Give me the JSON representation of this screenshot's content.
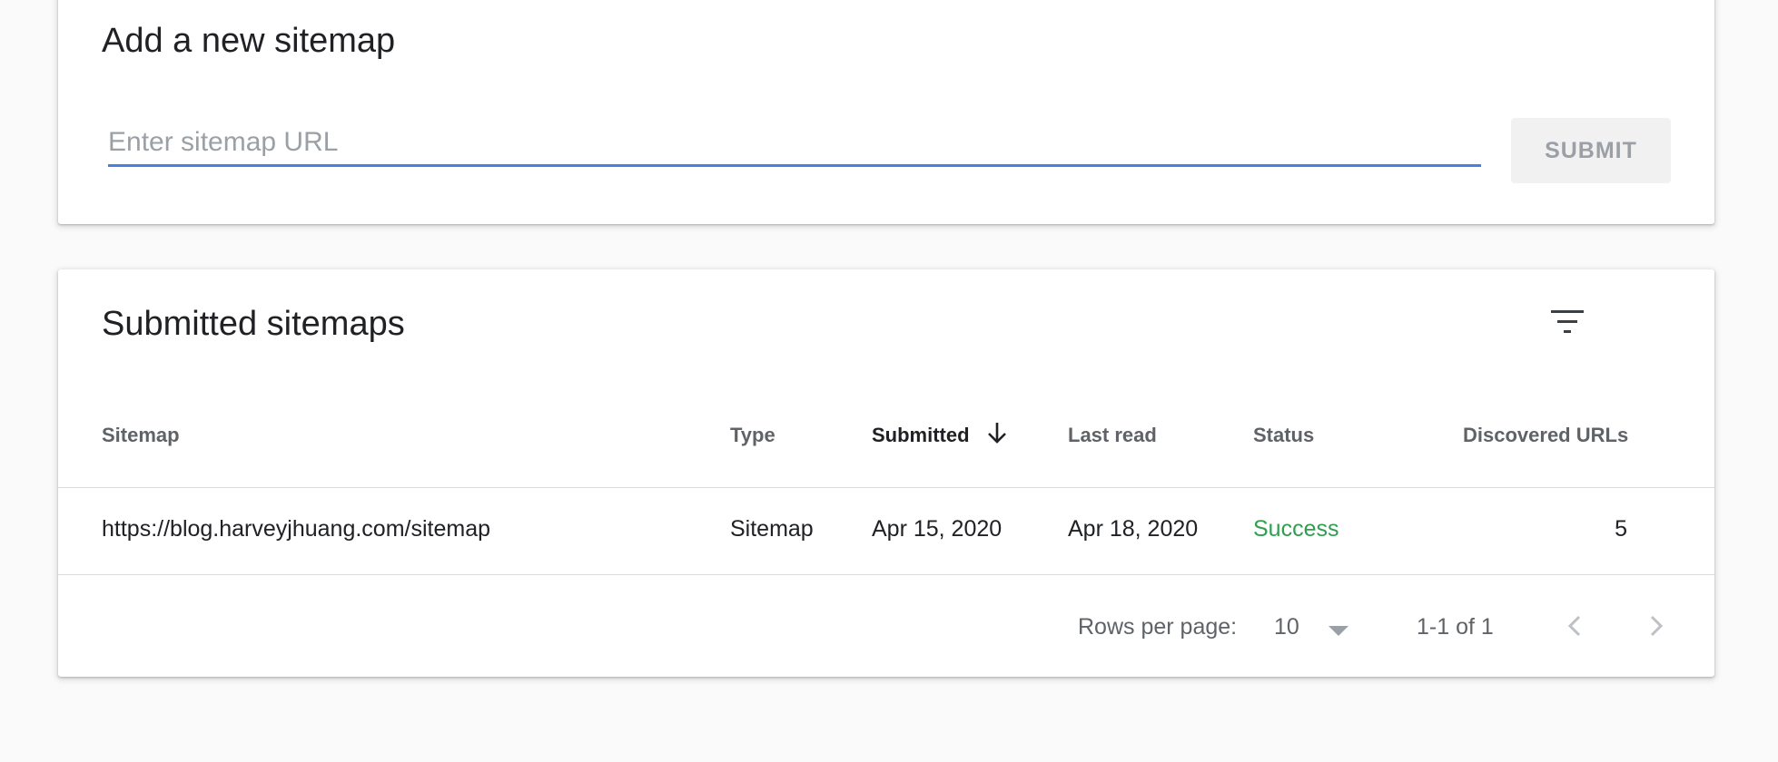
{
  "add_sitemap": {
    "title": "Add a new sitemap",
    "input_placeholder": "Enter sitemap URL",
    "input_value": "",
    "submit_label": "SUBMIT"
  },
  "submitted": {
    "title": "Submitted sitemaps",
    "columns": [
      "Sitemap",
      "Type",
      "Submitted",
      "Last read",
      "Status",
      "Discovered URLs"
    ],
    "sorted_column": "Submitted",
    "sort_direction": "descending",
    "rows": [
      {
        "sitemap": "https://blog.harveyjhuang.com/sitemap",
        "type": "Sitemap",
        "submitted": "Apr 15, 2020",
        "last_read": "Apr 18, 2020",
        "status": "Success",
        "discovered_urls": "5"
      }
    ],
    "pagination": {
      "rows_per_page_label": "Rows per page:",
      "rows_per_page_value": "10",
      "range_text": "1-1 of 1"
    }
  },
  "colors": {
    "page_background": "#fafafa",
    "card_background": "#ffffff",
    "input_underline": "#4a7fe0",
    "status_success": "#2e9e4f",
    "muted_text": "#5f6368",
    "primary_text": "#202124",
    "disabled_button_bg": "#f1f1f1",
    "disabled_button_text": "#9aa0a6"
  },
  "icons": {
    "filter": "filter-list-icon",
    "sort": "arrow-down-icon",
    "dropdown": "caret-down-icon",
    "prev": "chevron-left-icon",
    "next": "chevron-right-icon"
  }
}
